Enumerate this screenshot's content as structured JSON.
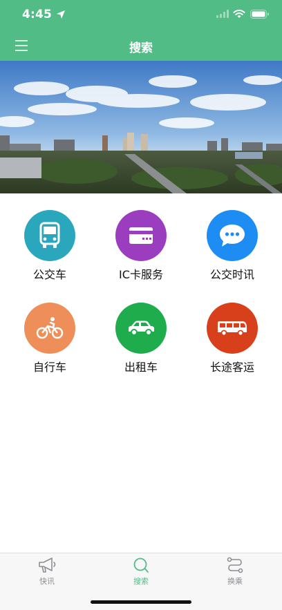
{
  "status_bar": {
    "time": "4:45"
  },
  "nav": {
    "title": "搜索",
    "menu_icon": "hamburger-menu-icon"
  },
  "banner": {
    "description_icon": "city-skyline-photo"
  },
  "services": [
    {
      "label": "公交车",
      "icon": "bus-icon",
      "color": "#2aa6bd"
    },
    {
      "label": "IC卡服务",
      "icon": "card-icon",
      "color": "#9b3dbf"
    },
    {
      "label": "公交时讯",
      "icon": "chat-bubble-icon",
      "color": "#1d8cf3"
    },
    {
      "label": "自行车",
      "icon": "bicycle-icon",
      "color": "#ee8f5a"
    },
    {
      "label": "出租车",
      "icon": "taxi-icon",
      "color": "#1fac4c"
    },
    {
      "label": "长途客运",
      "icon": "coach-icon",
      "color": "#d8401b"
    }
  ],
  "tabs": [
    {
      "label": "快讯",
      "icon": "megaphone-icon",
      "active": false
    },
    {
      "label": "搜索",
      "icon": "search-icon",
      "active": true
    },
    {
      "label": "换乘",
      "icon": "route-transfer-icon",
      "active": false
    }
  ],
  "colors": {
    "brand": "#52bc86",
    "tab_active": "#52bc86",
    "tab_inactive": "#8e8e93"
  }
}
